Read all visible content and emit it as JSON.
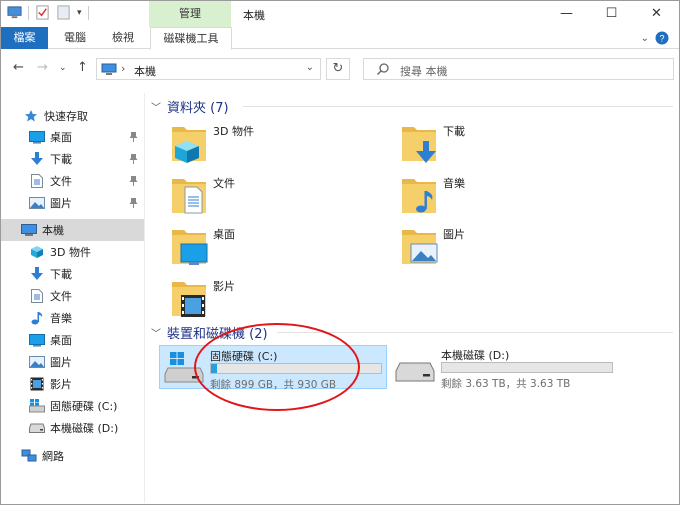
{
  "window": {
    "title": "本機",
    "context_tab": "管理",
    "controls": {
      "minimize": "—",
      "maximize": "☐",
      "close": "✕"
    }
  },
  "ribbon": {
    "file_tab": "檔案",
    "tabs": [
      "電腦",
      "檢視",
      "磁碟機工具"
    ]
  },
  "address": {
    "path": "本機",
    "search_placeholder": "搜尋 本機"
  },
  "nav": {
    "quick_access": "快速存取",
    "quick_items": [
      "桌面",
      "下載",
      "文件",
      "圖片"
    ],
    "this_pc": "本機",
    "pc_items": [
      "3D 物件",
      "下載",
      "文件",
      "音樂",
      "桌面",
      "圖片",
      "影片",
      "固態硬碟 (C:)",
      "本機磁碟 (D:)"
    ],
    "network": "網路"
  },
  "folders": {
    "header": "資料夾 (7)",
    "items": [
      "3D 物件",
      "下載",
      "文件",
      "音樂",
      "桌面",
      "圖片",
      "影片"
    ]
  },
  "devices": {
    "header": "裝置和磁碟機 (2)",
    "drives": [
      {
        "name": "固態硬碟 (C:)",
        "info": "剩餘 899 GB，共 930 GB",
        "used_fraction": 0.033
      },
      {
        "name": "本機磁碟 (D:)",
        "info": "剩餘 3.63 TB，共 3.63 TB",
        "used_fraction": 0.0
      }
    ]
  },
  "colors": {
    "accent": "#1e6fc0",
    "context_tab_bg": "#d9f0d0",
    "group_header": "#1e3287",
    "annotation": "#e0161b",
    "selection": "#cce8ff"
  }
}
